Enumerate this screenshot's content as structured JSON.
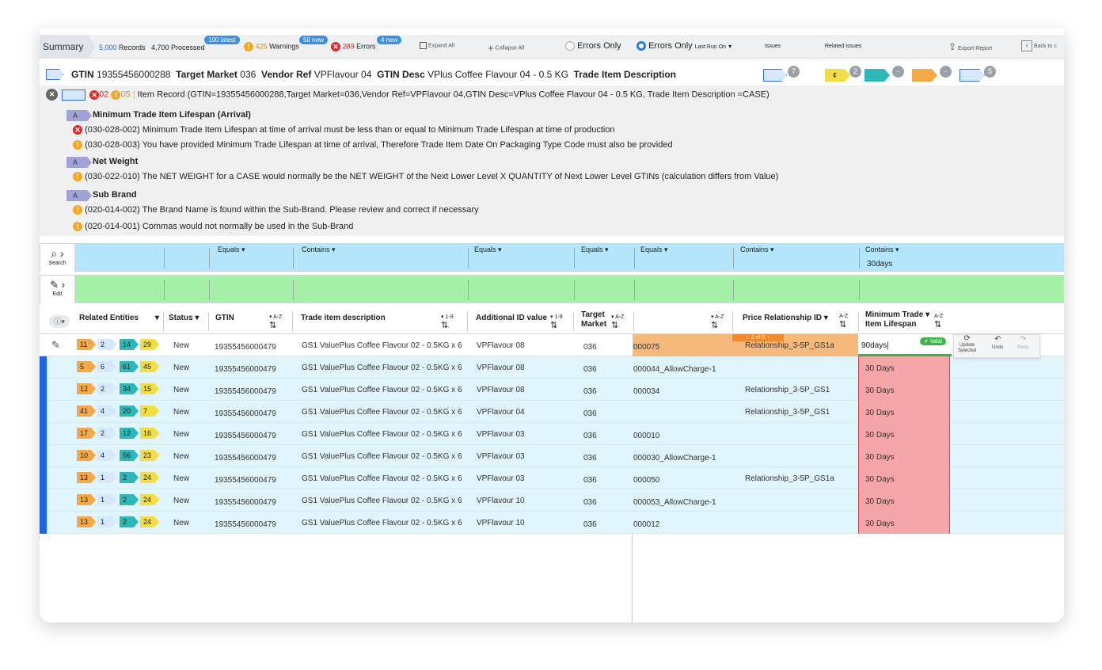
{
  "summary": {
    "label": "Summary",
    "records": "5,000",
    "records_label": "Records",
    "processed": "4,700",
    "processed_label": "Processed",
    "warnings": "425",
    "warnings_label": "Warnings",
    "errors": "289",
    "errors_label": "Errors",
    "badge_latest": "100 latest",
    "badge_new_warn": "50 new",
    "badge_new_err": "4 new",
    "expand_all": "Expand All",
    "collapse_all": "Collapse All",
    "errors_only_1": "Errors Only",
    "errors_only_2": "Errors Only",
    "last_run": "Last Run On",
    "issues": "Issues",
    "related_issues": "Related Issues",
    "export": "Export Report",
    "back": "Back to c"
  },
  "gtin_bar": {
    "gtin_label": "GTIN",
    "gtin": "19355456000288",
    "tm_label": "Target Market",
    "tm": "036",
    "vendor_label": "Vendor Ref",
    "vendor": "VPFlavour 04",
    "desc_label": "GTIN Desc",
    "desc": "VPlus Coffee Flavour 04 - 0.5 KG",
    "tid_label": "Trade Item Description",
    "counts": [
      "7",
      "2",
      "-",
      "-",
      "5"
    ]
  },
  "record": {
    "errors": "02",
    "warnings": "05",
    "text": "Item Record (GTIN=19355456000288,Target Market=036,Vendor Ref=VPFlavour 04,GTIN Desc=VPlus Coffee Flavour 04 - 0.5 KG, Trade Item Description =CASE)"
  },
  "issue_groups": [
    {
      "tag": "A",
      "title": "Minimum Trade Item Lifespan (Arrival)",
      "items": [
        {
          "type": "error",
          "text": "(030-028-002) Minimum Trade Item Lifespan at time of arrival must be less than or equal to Minimum Trade Lifespan at time of production"
        },
        {
          "type": "warn",
          "text": "(030-028-003) You have provided Minimum Trade Lifespan at time of arrival, Therefore Trade Item Date On Packaging Type Code must also be provided"
        }
      ]
    },
    {
      "tag": "A",
      "title": "Net Weight",
      "items": [
        {
          "type": "warn",
          "text": "(030-022-010) The NET WEIGHT for a CASE would normally be the NET WEIGHT of the Next Lower Level X QUANTITY of Next Lower Level GTINs (calculation differs from Value)"
        }
      ]
    },
    {
      "tag": "A",
      "title": "Sub Brand",
      "items": [
        {
          "type": "warn",
          "text": "(020-014-002) The Brand Name is found within the Sub-Brand. Please review and correct if necessary"
        },
        {
          "type": "warn",
          "text": "(020-014-001) Commas would not normally be used in the Sub-Brand"
        }
      ]
    }
  ],
  "search": {
    "label": "Search",
    "f1": "Equals",
    "f2": "Contains",
    "f3": "Equals",
    "f4": "Equals",
    "f5": "Equals",
    "f6": "Contains",
    "f7": "Contains",
    "f7_value": "30days"
  },
  "edit": {
    "label": "Edit"
  },
  "columns": {
    "related": "Related Entities",
    "status": "Status",
    "gtin": "GTIN",
    "desc": "Trade item description",
    "addid": "Additional ID value",
    "tm1": "Target",
    "tm2": "Market",
    "price": "Price Relationship ID",
    "min1": "Minimum Trade",
    "min2": "Item Lifespan",
    "az": "A-Z",
    "num": "1-9"
  },
  "editor": {
    "input_value": "90days",
    "valid": "Valid",
    "pager": "2 of 5",
    "update1": "Update",
    "update2": "Selected",
    "undo": "Undo",
    "redo": "Redo"
  },
  "rows": [
    {
      "t": [
        "11",
        "2",
        "14",
        "29"
      ],
      "status": "New",
      "gtin": "19355456000479",
      "desc": "GS1 ValuePlus Coffee Flavour 02 - 0.5KG x 6",
      "addid": "VPFlavour 08",
      "tm": "036",
      "alt": "000075",
      "price": "Relationship_3-5P_GS1a",
      "min": ""
    },
    {
      "t": [
        "5",
        "6",
        "61",
        "45"
      ],
      "status": "New",
      "gtin": "19355456000479",
      "desc": "GS1 ValuePlus Coffee Flavour 02 - 0.5KG x 6",
      "addid": "VPFlavour 08",
      "tm": "036",
      "alt": "000044_AllowCharge-1",
      "price": "",
      "min": "30 Days"
    },
    {
      "t": [
        "12",
        "2",
        "34",
        "15"
      ],
      "status": "New",
      "gtin": "19355456000479",
      "desc": "GS1 ValuePlus Coffee Flavour 02 - 0.5KG x 6",
      "addid": "VPFlavour 08",
      "tm": "036",
      "alt": "000034",
      "price": "Relationship_3-5P_GS1",
      "min": "30 Days"
    },
    {
      "t": [
        "41",
        "4",
        "20",
        "7"
      ],
      "status": "New",
      "gtin": "19355456000479",
      "desc": "GS1 ValuePlus Coffee Flavour 02 - 0.5KG x 6",
      "addid": "VPFlavour 04",
      "tm": "036",
      "alt": "",
      "price": "Relationship_3-5P_GS1",
      "min": "30 Days"
    },
    {
      "t": [
        "17",
        "2",
        "12",
        "16"
      ],
      "status": "New",
      "gtin": "19355456000479",
      "desc": "GS1 ValuePlus Coffee Flavour 02 - 0.5KG x 6",
      "addid": "VPFlavour 03",
      "tm": "036",
      "alt": "000010",
      "price": "",
      "min": "30 Days"
    },
    {
      "t": [
        "10",
        "4",
        "56",
        "23"
      ],
      "status": "New",
      "gtin": "19355456000479",
      "desc": "GS1 ValuePlus Coffee Flavour 02 - 0.5KG x 6",
      "addid": "VPFlavour 03",
      "tm": "036",
      "alt": "000030_AllowCharge-1",
      "price": "",
      "min": "30 Days"
    },
    {
      "t": [
        "13",
        "1",
        "2",
        "24"
      ],
      "status": "New",
      "gtin": "19355456000479",
      "desc": "GS1 ValuePlus Coffee Flavour 02 - 0.5KG x 6",
      "addid": "VPFlavour 03",
      "tm": "036",
      "alt": "000050",
      "price": "Relationship_3-5P_GS1a",
      "min": "30 Days"
    },
    {
      "t": [
        "13",
        "1",
        "2",
        "24"
      ],
      "status": "New",
      "gtin": "19355456000479",
      "desc": "GS1 ValuePlus Coffee Flavour 02 - 0.5KG x 6",
      "addid": "VPFlavour 10",
      "tm": "036",
      "alt": "000053_AllowCharge-1",
      "price": "",
      "min": "30 Days"
    },
    {
      "t": [
        "13",
        "1",
        "2",
        "24"
      ],
      "status": "New",
      "gtin": "19355456000479",
      "desc": "GS1 ValuePlus Coffee Flavour 02 - 0.5KG x 6",
      "addid": "VPFlavour 10",
      "tm": "036",
      "alt": "000012",
      "price": "",
      "min": "30 Days"
    }
  ]
}
